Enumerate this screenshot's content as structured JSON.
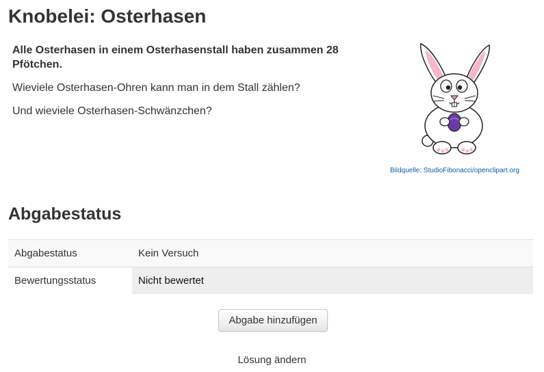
{
  "page": {
    "title": "Knobelei: Osterhasen"
  },
  "intro": {
    "bold_text": "Alle Osterhasen in einem Osterhasenstall haben zusammen 28 Pfötchen.",
    "question1": "Wieviele Osterhasen-Ohren kann man in dem Stall zählen?",
    "question2": "Und wieviele Osterhasen-Schwänzchen?"
  },
  "image": {
    "icon": "easter-bunny-illustration",
    "credit": "Bildquelle: StudioFibonacci/openclipart.org"
  },
  "status": {
    "heading": "Abgabestatus",
    "rows": [
      {
        "label": "Abgabestatus",
        "value": "Kein Versuch"
      },
      {
        "label": "Bewertungsstatus",
        "value": "Nicht bewertet"
      }
    ]
  },
  "actions": {
    "add_submission": "Abgabe hinzufügen",
    "change_solution": "Lösung ändern"
  },
  "colors": {
    "link": "#0b5ea8",
    "text": "#333333",
    "graded_cell_bg": "#eeeeee"
  }
}
